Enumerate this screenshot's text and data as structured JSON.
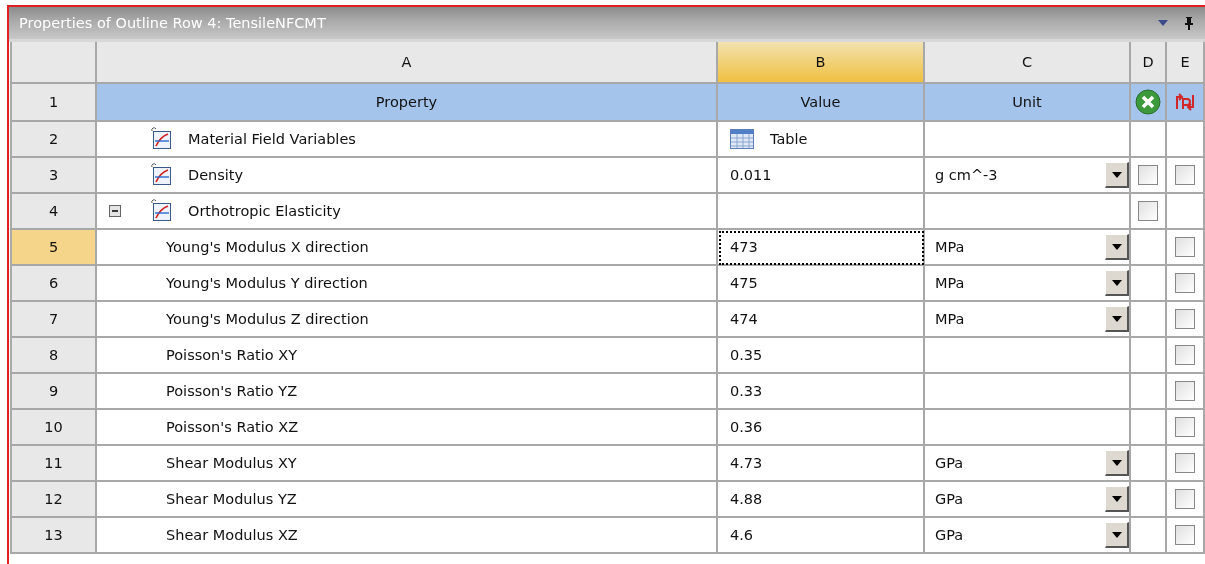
{
  "panel": {
    "title": "Properties of Outline Row 4: TensileNFCMT"
  },
  "columns": [
    {
      "label": "A",
      "selected": false
    },
    {
      "label": "B",
      "selected": true
    },
    {
      "label": "C",
      "selected": false
    },
    {
      "label": "D",
      "selected": false
    },
    {
      "label": "E",
      "selected": false
    }
  ],
  "header_row": {
    "number": "1",
    "property": "Property",
    "value": "Value",
    "unit": "Unit"
  },
  "rows": [
    {
      "number": "2",
      "property": "Material Field Variables",
      "selected": false,
      "value": {
        "kind": "table",
        "text": "Table"
      }
    },
    {
      "number": "3",
      "property": "Density",
      "selected": false,
      "value": {
        "text": "0.011"
      },
      "unit": {
        "text": "g cm^-3",
        "dropdown": true
      },
      "d_checkbox": {
        "checked": false
      },
      "e_checkbox": {
        "checked": false
      }
    },
    {
      "number": "4",
      "property": "Orthotropic Elasticity",
      "selected": false,
      "expanded": true,
      "d_checkbox": {
        "checked": false
      },
      "children": [
        {
          "number": "5",
          "property": "Young's Modulus X direction",
          "selected": true,
          "value": {
            "text": "473"
          },
          "unit": {
            "text": "MPa",
            "dropdown": true
          },
          "e_checkbox": {
            "checked": false
          }
        },
        {
          "number": "6",
          "property": "Young's Modulus Y direction",
          "selected": false,
          "value": {
            "text": "475"
          },
          "unit": {
            "text": "MPa",
            "dropdown": true
          },
          "e_checkbox": {
            "checked": false
          }
        },
        {
          "number": "7",
          "property": "Young's Modulus Z direction",
          "selected": false,
          "value": {
            "text": "474"
          },
          "unit": {
            "text": "MPa",
            "dropdown": true
          },
          "e_checkbox": {
            "checked": false
          }
        },
        {
          "number": "8",
          "property": "Poisson's Ratio XY",
          "selected": false,
          "value": {
            "text": "0.35"
          },
          "e_checkbox": {
            "checked": false
          }
        },
        {
          "number": "9",
          "property": "Poisson's Ratio YZ",
          "selected": false,
          "value": {
            "text": "0.33"
          },
          "e_checkbox": {
            "checked": false
          }
        },
        {
          "number": "10",
          "property": "Poisson's Ratio XZ",
          "selected": false,
          "value": {
            "text": "0.36"
          },
          "e_checkbox": {
            "checked": false
          }
        },
        {
          "number": "11",
          "property": "Shear Modulus XY",
          "selected": false,
          "value": {
            "text": "4.73"
          },
          "unit": {
            "text": "GPa",
            "dropdown": true
          },
          "e_checkbox": {
            "checked": false
          }
        },
        {
          "number": "12",
          "property": "Shear Modulus YZ",
          "selected": false,
          "value": {
            "text": "4.88"
          },
          "unit": {
            "text": "GPa",
            "dropdown": true
          },
          "e_checkbox": {
            "checked": false
          }
        },
        {
          "number": "13",
          "property": "Shear Modulus XZ",
          "selected": false,
          "value": {
            "text": "4.6"
          },
          "unit": {
            "text": "GPa",
            "dropdown": true
          },
          "e_checkbox": {
            "checked": false
          }
        }
      ]
    }
  ]
}
